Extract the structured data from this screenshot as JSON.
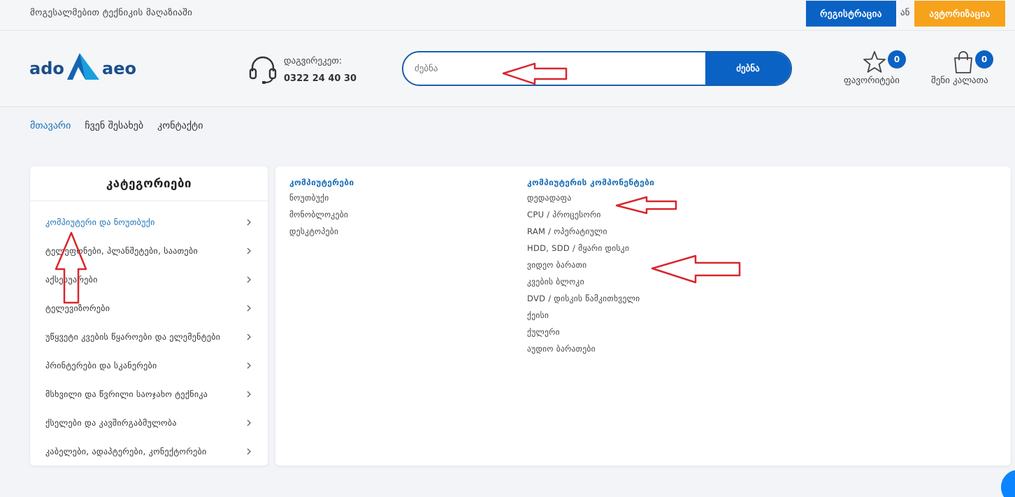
{
  "topbar": {
    "welcome": "მოგესალმებით ტექნიკის მაღაზიაში",
    "register_label": "რეგისტრაცია",
    "or_label": "ან",
    "login_label": "ავტორიზაცია"
  },
  "header": {
    "logo_text": "ado aeo",
    "phone_label": "დაგვირეკეთ:",
    "phone_number": "0322 24 40 30",
    "search_placeholder": "ძებნა",
    "search_button": "ძებნა",
    "favorites_label": "ფავორიტები",
    "favorites_count": "0",
    "cart_label": "შენი კალათა",
    "cart_count": "0"
  },
  "nav": {
    "items": [
      "მთავარი",
      "ჩვენ შესახებ",
      "კონტაქტი"
    ]
  },
  "categories": {
    "title": "კატეგორიები",
    "items": [
      "კომპიუტერი და ნოუთბუქი",
      "ტელეფონები, პლანშეტები, საათები",
      "აქსესუარები",
      "ტელევიზორები",
      "უწყვეტი კვების წყაროები და ელემენტები",
      "პრინტერები და სკანერები",
      "მსხვილი და წვრილი საოჯახო ტექნიკა",
      "ქსელები და კავშირგაბმულობა",
      "კაბელები, ადაპტერები, კონექტორები"
    ]
  },
  "mega_menu": {
    "col1": {
      "heading": "კომპიუტერები",
      "items": [
        "ნოუთბუქი",
        "მონობლოკები",
        "დესკტოპები"
      ]
    },
    "col2": {
      "heading": "კომპიუტერის კომპონენტები",
      "items": [
        "დედადაფა",
        "CPU / პროცესორი",
        "RAM / ოპერატიული",
        "HDD, SDD / მყარი დისკი",
        "ვიდეო ბარათი",
        "კვების ბლოკი",
        "DVD / დისკის წამკითხველი",
        "ქეისი",
        "ქულერი",
        "აუდიო ბარათები"
      ]
    }
  },
  "colors": {
    "primary_blue": "#0a62c4",
    "accent_orange": "#f7a21b",
    "link_blue": "#1a6fb8",
    "annotation_red": "#d9262c"
  }
}
